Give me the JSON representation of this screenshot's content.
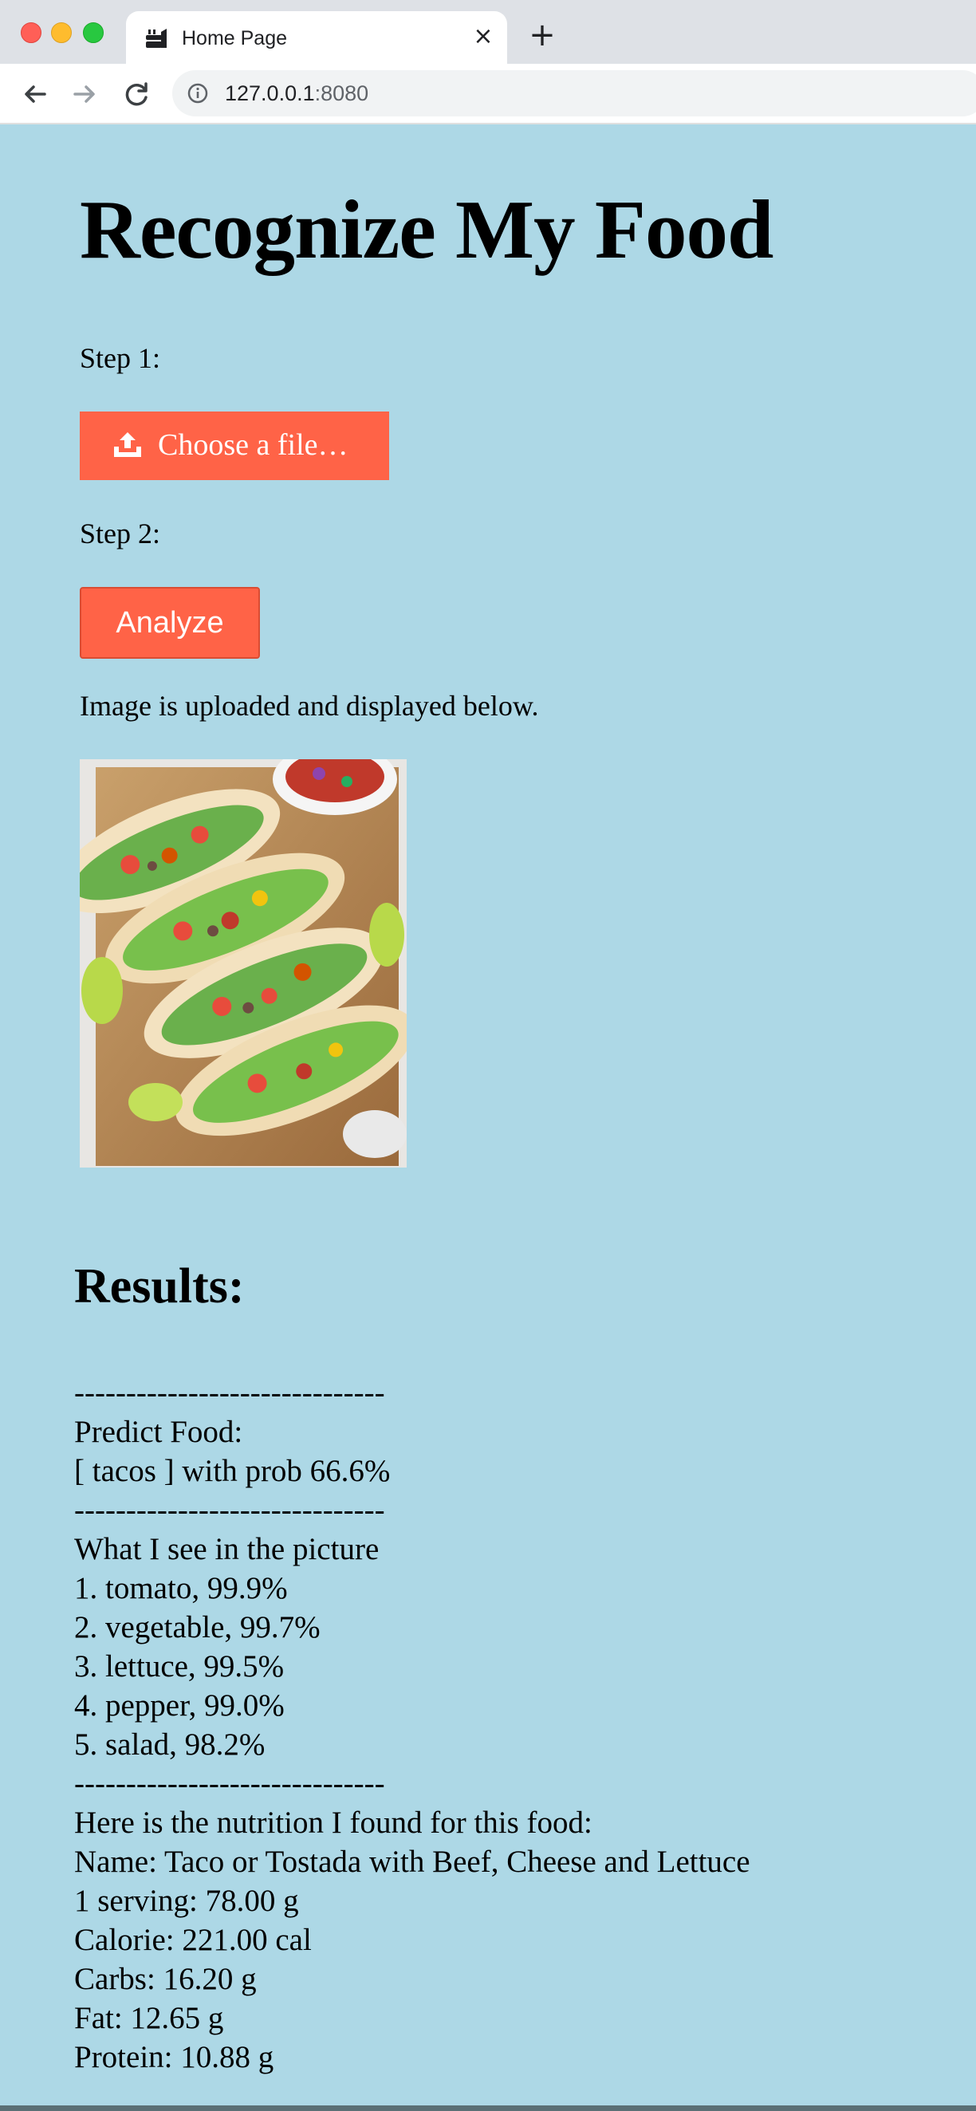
{
  "browser": {
    "tab_title": "Home Page",
    "url_host": "127.0.0.1",
    "url_port": ":8080"
  },
  "page": {
    "title": "Recognize My Food",
    "step1_label": "Step 1:",
    "upload_button_label": "Choose a file…",
    "step2_label": "Step 2:",
    "analyze_button_label": "Analyze",
    "upload_message": "Image is uploaded and displayed below."
  },
  "results": {
    "heading": "Results:",
    "separator": "------------------------------",
    "predict_label": "Predict Food:",
    "prediction": "[ tacos ] with prob 66.6%",
    "see_label": "What I see in the picture",
    "detections": [
      "1. tomato, 99.9%",
      "2. vegetable, 99.7%",
      "3. lettuce, 99.5%",
      "4. pepper, 99.0%",
      "5. salad, 98.2%"
    ],
    "nutrition_label": "Here is the nutrition I found for this food:",
    "nutrition": [
      "Name: Taco or Tostada with Beef, Cheese and Lettuce",
      "1 serving: 78.00 g",
      "Calorie: 221.00 cal",
      "Carbs: 16.20 g",
      "Fat: 12.65 g",
      "Protein: 10.88 g"
    ]
  },
  "colors": {
    "page_background": "#add8e6",
    "button": "#ff6347"
  }
}
